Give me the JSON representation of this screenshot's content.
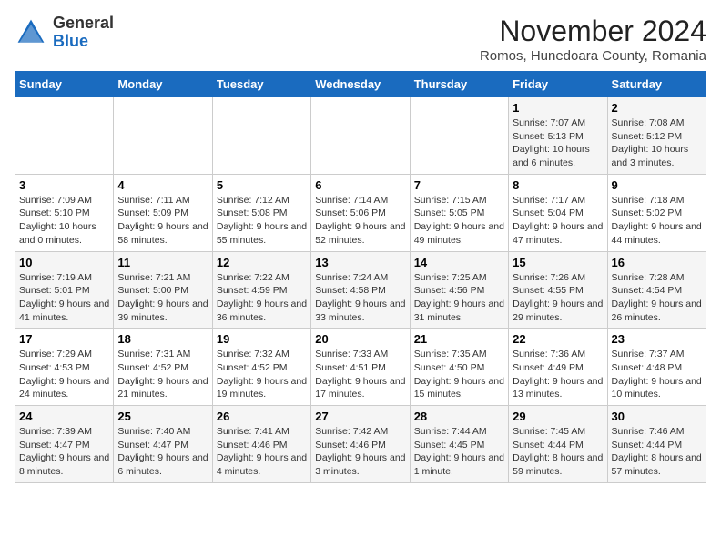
{
  "logo": {
    "general": "General",
    "blue": "Blue"
  },
  "title": "November 2024",
  "location": "Romos, Hunedoara County, Romania",
  "days_header": [
    "Sunday",
    "Monday",
    "Tuesday",
    "Wednesday",
    "Thursday",
    "Friday",
    "Saturday"
  ],
  "weeks": [
    [
      {
        "num": "",
        "info": ""
      },
      {
        "num": "",
        "info": ""
      },
      {
        "num": "",
        "info": ""
      },
      {
        "num": "",
        "info": ""
      },
      {
        "num": "",
        "info": ""
      },
      {
        "num": "1",
        "info": "Sunrise: 7:07 AM\nSunset: 5:13 PM\nDaylight: 10 hours and 6 minutes."
      },
      {
        "num": "2",
        "info": "Sunrise: 7:08 AM\nSunset: 5:12 PM\nDaylight: 10 hours and 3 minutes."
      }
    ],
    [
      {
        "num": "3",
        "info": "Sunrise: 7:09 AM\nSunset: 5:10 PM\nDaylight: 10 hours and 0 minutes."
      },
      {
        "num": "4",
        "info": "Sunrise: 7:11 AM\nSunset: 5:09 PM\nDaylight: 9 hours and 58 minutes."
      },
      {
        "num": "5",
        "info": "Sunrise: 7:12 AM\nSunset: 5:08 PM\nDaylight: 9 hours and 55 minutes."
      },
      {
        "num": "6",
        "info": "Sunrise: 7:14 AM\nSunset: 5:06 PM\nDaylight: 9 hours and 52 minutes."
      },
      {
        "num": "7",
        "info": "Sunrise: 7:15 AM\nSunset: 5:05 PM\nDaylight: 9 hours and 49 minutes."
      },
      {
        "num": "8",
        "info": "Sunrise: 7:17 AM\nSunset: 5:04 PM\nDaylight: 9 hours and 47 minutes."
      },
      {
        "num": "9",
        "info": "Sunrise: 7:18 AM\nSunset: 5:02 PM\nDaylight: 9 hours and 44 minutes."
      }
    ],
    [
      {
        "num": "10",
        "info": "Sunrise: 7:19 AM\nSunset: 5:01 PM\nDaylight: 9 hours and 41 minutes."
      },
      {
        "num": "11",
        "info": "Sunrise: 7:21 AM\nSunset: 5:00 PM\nDaylight: 9 hours and 39 minutes."
      },
      {
        "num": "12",
        "info": "Sunrise: 7:22 AM\nSunset: 4:59 PM\nDaylight: 9 hours and 36 minutes."
      },
      {
        "num": "13",
        "info": "Sunrise: 7:24 AM\nSunset: 4:58 PM\nDaylight: 9 hours and 33 minutes."
      },
      {
        "num": "14",
        "info": "Sunrise: 7:25 AM\nSunset: 4:56 PM\nDaylight: 9 hours and 31 minutes."
      },
      {
        "num": "15",
        "info": "Sunrise: 7:26 AM\nSunset: 4:55 PM\nDaylight: 9 hours and 29 minutes."
      },
      {
        "num": "16",
        "info": "Sunrise: 7:28 AM\nSunset: 4:54 PM\nDaylight: 9 hours and 26 minutes."
      }
    ],
    [
      {
        "num": "17",
        "info": "Sunrise: 7:29 AM\nSunset: 4:53 PM\nDaylight: 9 hours and 24 minutes."
      },
      {
        "num": "18",
        "info": "Sunrise: 7:31 AM\nSunset: 4:52 PM\nDaylight: 9 hours and 21 minutes."
      },
      {
        "num": "19",
        "info": "Sunrise: 7:32 AM\nSunset: 4:52 PM\nDaylight: 9 hours and 19 minutes."
      },
      {
        "num": "20",
        "info": "Sunrise: 7:33 AM\nSunset: 4:51 PM\nDaylight: 9 hours and 17 minutes."
      },
      {
        "num": "21",
        "info": "Sunrise: 7:35 AM\nSunset: 4:50 PM\nDaylight: 9 hours and 15 minutes."
      },
      {
        "num": "22",
        "info": "Sunrise: 7:36 AM\nSunset: 4:49 PM\nDaylight: 9 hours and 13 minutes."
      },
      {
        "num": "23",
        "info": "Sunrise: 7:37 AM\nSunset: 4:48 PM\nDaylight: 9 hours and 10 minutes."
      }
    ],
    [
      {
        "num": "24",
        "info": "Sunrise: 7:39 AM\nSunset: 4:47 PM\nDaylight: 9 hours and 8 minutes."
      },
      {
        "num": "25",
        "info": "Sunrise: 7:40 AM\nSunset: 4:47 PM\nDaylight: 9 hours and 6 minutes."
      },
      {
        "num": "26",
        "info": "Sunrise: 7:41 AM\nSunset: 4:46 PM\nDaylight: 9 hours and 4 minutes."
      },
      {
        "num": "27",
        "info": "Sunrise: 7:42 AM\nSunset: 4:46 PM\nDaylight: 9 hours and 3 minutes."
      },
      {
        "num": "28",
        "info": "Sunrise: 7:44 AM\nSunset: 4:45 PM\nDaylight: 9 hours and 1 minute."
      },
      {
        "num": "29",
        "info": "Sunrise: 7:45 AM\nSunset: 4:44 PM\nDaylight: 8 hours and 59 minutes."
      },
      {
        "num": "30",
        "info": "Sunrise: 7:46 AM\nSunset: 4:44 PM\nDaylight: 8 hours and 57 minutes."
      }
    ]
  ]
}
